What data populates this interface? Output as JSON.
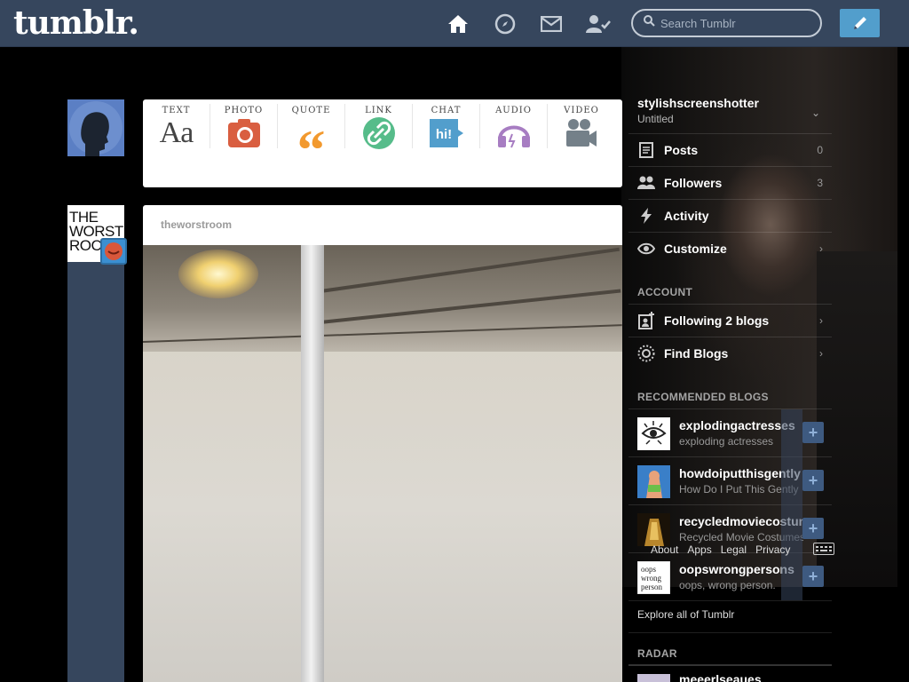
{
  "header": {
    "logo": "tumblr.",
    "search_placeholder": "Search Tumblr"
  },
  "post_types": [
    {
      "label": "TEXT",
      "icon": "text-icon",
      "glyph": "Aa",
      "color": "#444444"
    },
    {
      "label": "PHOTO",
      "icon": "camera-icon",
      "color": "#d95e40"
    },
    {
      "label": "QUOTE",
      "icon": "quote-icon",
      "glyph": "“",
      "color": "#f2992e"
    },
    {
      "label": "LINK",
      "icon": "link-icon",
      "color": "#56bc8a"
    },
    {
      "label": "CHAT",
      "icon": "chat-icon",
      "glyph": "hi!",
      "color": "#529ecc"
    },
    {
      "label": "AUDIO",
      "icon": "headphones-icon",
      "color": "#a77dc2"
    },
    {
      "label": "VIDEO",
      "icon": "video-camera-icon",
      "color": "#748089"
    }
  ],
  "post": {
    "blog_name": "theworstroom"
  },
  "avatar_blog_text": "THE WORST ROC",
  "sidebar": {
    "blog_name": "stylishscreenshotter",
    "blog_subtitle": "Untitled",
    "menu": [
      {
        "label": "Posts",
        "icon": "posts-icon",
        "right": "0"
      },
      {
        "label": "Followers",
        "icon": "followers-icon",
        "right": "3"
      },
      {
        "label": "Activity",
        "icon": "lightning-icon",
        "right": ""
      },
      {
        "label": "Customize",
        "icon": "eye-icon",
        "right": "›"
      }
    ],
    "account_heading": "ACCOUNT",
    "account": [
      {
        "label": "Following 2 blogs",
        "icon": "following-icon",
        "right": "›"
      },
      {
        "label": "Find Blogs",
        "icon": "find-blogs-icon",
        "right": "›"
      }
    ],
    "recommended_heading": "RECOMMENDED BLOGS",
    "recommended": [
      {
        "name": "explodingactresses",
        "subtitle": "exploding actresses",
        "avatar_color": "#ffffff"
      },
      {
        "name": "howdoiputthisgently",
        "subtitle": "How Do I Put This Gently",
        "avatar_color": "#3a7fc8"
      },
      {
        "name": "recycledmoviecostumes",
        "subtitle": "Recycled Movie Costumes",
        "avatar_color": "#b8862c"
      },
      {
        "name": "oopswrongpersons",
        "subtitle": "oops, wrong person.",
        "avatar_color": "#ffffff"
      }
    ],
    "follow_label": "+",
    "footer_links": [
      "About",
      "Apps",
      "Legal",
      "Privacy"
    ],
    "explore": "Explore all of Tumblr",
    "radar_heading": "RADAR",
    "radar_peek": "meeerlseaues"
  }
}
